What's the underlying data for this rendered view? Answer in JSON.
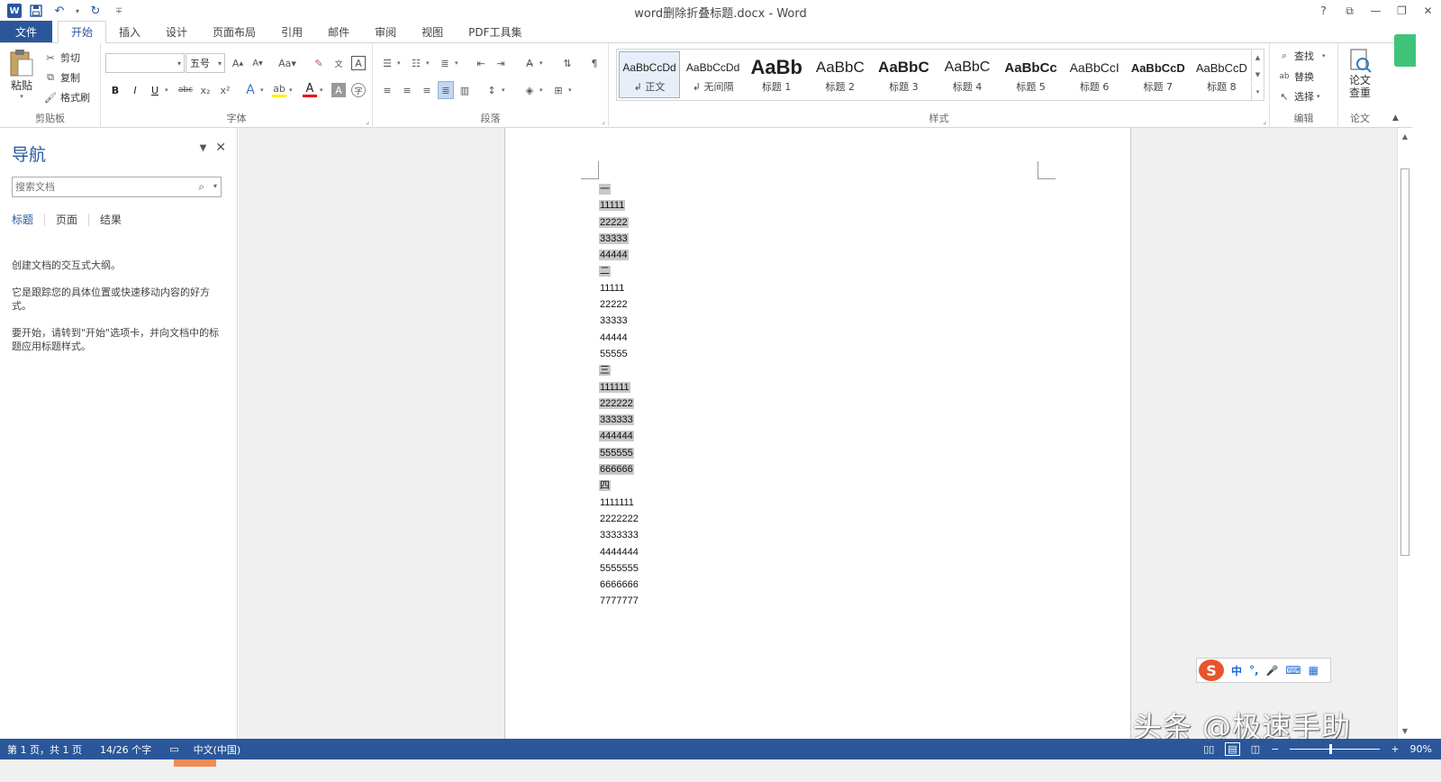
{
  "window": {
    "title": "word删除折叠标题.docx - Word",
    "controls": [
      "?",
      "⧉",
      "—",
      "❐",
      "✕"
    ]
  },
  "qat": {
    "logo": "W",
    "customize": "∓"
  },
  "tabs": [
    "文件",
    "开始",
    "插入",
    "设计",
    "页面布局",
    "引用",
    "邮件",
    "审阅",
    "视图",
    "PDF工具集"
  ],
  "ribbon": {
    "clipboard": {
      "label": "剪贴板",
      "paste": "粘贴",
      "cut": "剪切",
      "copy": "复制",
      "format_painter": "格式刷"
    },
    "font": {
      "label": "字体",
      "font_name": "",
      "font_size": "五号",
      "buttons": [
        "B",
        "I",
        "U",
        "abc",
        "x₂",
        "x²"
      ]
    },
    "paragraph": {
      "label": "段落"
    },
    "styles": {
      "label": "样式",
      "items": [
        {
          "preview": "AaBbCcDd",
          "name": "↲ 正文",
          "selected": true
        },
        {
          "preview": "AaBbCcDd",
          "name": "↲ 无间隔",
          "selected": false
        },
        {
          "preview": "AaBb",
          "name": "标题 1",
          "selected": false
        },
        {
          "preview": "AaBbC",
          "name": "标题 2",
          "selected": false
        },
        {
          "preview": "AaBbC",
          "name": "标题 3",
          "selected": false
        },
        {
          "preview": "AaBbC",
          "name": "标题 4",
          "selected": false
        },
        {
          "preview": "AaBbCc",
          "name": "标题 5",
          "selected": false
        },
        {
          "preview": "AaBbCcI",
          "name": "标题 6",
          "selected": false
        },
        {
          "preview": "AaBbCcD",
          "name": "标题 7",
          "selected": false
        },
        {
          "preview": "AaBbCcD",
          "name": "标题 8",
          "selected": false
        }
      ]
    },
    "editing": {
      "label": "编辑",
      "find": "查找",
      "replace": "替换",
      "select": "选择"
    },
    "paper": {
      "label": "论文",
      "check": "论文查重"
    }
  },
  "nav": {
    "title": "导航",
    "search_placeholder": "搜索文档",
    "tabs": [
      "标题",
      "页面",
      "结果"
    ],
    "help": [
      "创建文档的交互式大纲。",
      "它是跟踪您的具体位置或快速移动内容的好方式。",
      "要开始，请转到\"开始\"选项卡，并向文档中的标题应用标题样式。"
    ]
  },
  "document": {
    "lines": [
      {
        "text": "一",
        "hl": true
      },
      {
        "text": "11111",
        "hl": true
      },
      {
        "text": "22222",
        "hl": true
      },
      {
        "text": "33333",
        "hl": true
      },
      {
        "text": "44444",
        "hl": true
      },
      {
        "text": "二",
        "hl": true
      },
      {
        "text": "11111",
        "hl": false
      },
      {
        "text": "22222",
        "hl": false
      },
      {
        "text": "33333",
        "hl": false
      },
      {
        "text": "44444",
        "hl": false
      },
      {
        "text": "55555",
        "hl": false
      },
      {
        "text": "三",
        "hl": true
      },
      {
        "text": "111111",
        "hl": true
      },
      {
        "text": "222222",
        "hl": true
      },
      {
        "text": "333333",
        "hl": true
      },
      {
        "text": "444444",
        "hl": true
      },
      {
        "text": "555555",
        "hl": true
      },
      {
        "text": "666666",
        "hl": true
      },
      {
        "text": "四",
        "hl": true
      },
      {
        "text": "1111111",
        "hl": false
      },
      {
        "text": "2222222",
        "hl": false
      },
      {
        "text": "3333333",
        "hl": false
      },
      {
        "text": "4444444",
        "hl": false
      },
      {
        "text": "5555555",
        "hl": false
      },
      {
        "text": "6666666",
        "hl": false
      },
      {
        "text": "7777777",
        "hl": false
      }
    ]
  },
  "ime": {
    "logo": "S",
    "items": [
      "中",
      "°,",
      "🎤",
      "⌨",
      "▦"
    ]
  },
  "watermark": "头条 @极速手助",
  "status": {
    "page": "第 1 页，共 1 页",
    "words": "14/26 个字",
    "language": "中文(中国)",
    "zoom": "90%"
  },
  "colors": {
    "accent": "#2b579a",
    "selection": "#c8c8c8"
  }
}
